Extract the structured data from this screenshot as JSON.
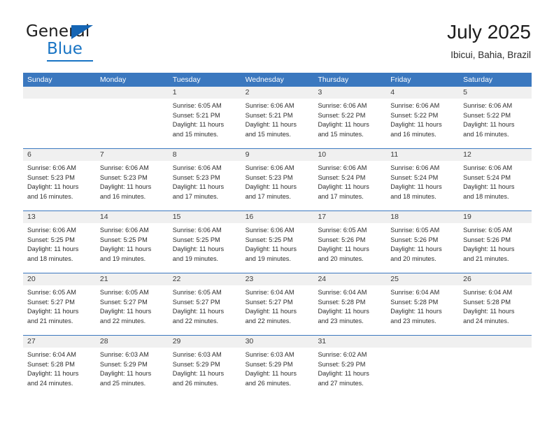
{
  "brand": {
    "word_one": "General",
    "word_two": "Blue",
    "accent_color": "#1874c4",
    "triangle_color": "#1565b4"
  },
  "header": {
    "title": "July 2025",
    "subtitle": "Ibicui, Bahia, Brazil"
  },
  "calendar": {
    "header_bg": "#3b78bf",
    "daynum_bg": "#f0f0f0",
    "weekdays": [
      "Sunday",
      "Monday",
      "Tuesday",
      "Wednesday",
      "Thursday",
      "Friday",
      "Saturday"
    ],
    "weeks": [
      [
        {
          "day": "",
          "lines": []
        },
        {
          "day": "",
          "lines": []
        },
        {
          "day": "1",
          "lines": [
            "Sunrise: 6:05 AM",
            "Sunset: 5:21 PM",
            "Daylight: 11 hours",
            "and 15 minutes."
          ]
        },
        {
          "day": "2",
          "lines": [
            "Sunrise: 6:06 AM",
            "Sunset: 5:21 PM",
            "Daylight: 11 hours",
            "and 15 minutes."
          ]
        },
        {
          "day": "3",
          "lines": [
            "Sunrise: 6:06 AM",
            "Sunset: 5:22 PM",
            "Daylight: 11 hours",
            "and 15 minutes."
          ]
        },
        {
          "day": "4",
          "lines": [
            "Sunrise: 6:06 AM",
            "Sunset: 5:22 PM",
            "Daylight: 11 hours",
            "and 16 minutes."
          ]
        },
        {
          "day": "5",
          "lines": [
            "Sunrise: 6:06 AM",
            "Sunset: 5:22 PM",
            "Daylight: 11 hours",
            "and 16 minutes."
          ]
        }
      ],
      [
        {
          "day": "6",
          "lines": [
            "Sunrise: 6:06 AM",
            "Sunset: 5:23 PM",
            "Daylight: 11 hours",
            "and 16 minutes."
          ]
        },
        {
          "day": "7",
          "lines": [
            "Sunrise: 6:06 AM",
            "Sunset: 5:23 PM",
            "Daylight: 11 hours",
            "and 16 minutes."
          ]
        },
        {
          "day": "8",
          "lines": [
            "Sunrise: 6:06 AM",
            "Sunset: 5:23 PM",
            "Daylight: 11 hours",
            "and 17 minutes."
          ]
        },
        {
          "day": "9",
          "lines": [
            "Sunrise: 6:06 AM",
            "Sunset: 5:23 PM",
            "Daylight: 11 hours",
            "and 17 minutes."
          ]
        },
        {
          "day": "10",
          "lines": [
            "Sunrise: 6:06 AM",
            "Sunset: 5:24 PM",
            "Daylight: 11 hours",
            "and 17 minutes."
          ]
        },
        {
          "day": "11",
          "lines": [
            "Sunrise: 6:06 AM",
            "Sunset: 5:24 PM",
            "Daylight: 11 hours",
            "and 18 minutes."
          ]
        },
        {
          "day": "12",
          "lines": [
            "Sunrise: 6:06 AM",
            "Sunset: 5:24 PM",
            "Daylight: 11 hours",
            "and 18 minutes."
          ]
        }
      ],
      [
        {
          "day": "13",
          "lines": [
            "Sunrise: 6:06 AM",
            "Sunset: 5:25 PM",
            "Daylight: 11 hours",
            "and 18 minutes."
          ]
        },
        {
          "day": "14",
          "lines": [
            "Sunrise: 6:06 AM",
            "Sunset: 5:25 PM",
            "Daylight: 11 hours",
            "and 19 minutes."
          ]
        },
        {
          "day": "15",
          "lines": [
            "Sunrise: 6:06 AM",
            "Sunset: 5:25 PM",
            "Daylight: 11 hours",
            "and 19 minutes."
          ]
        },
        {
          "day": "16",
          "lines": [
            "Sunrise: 6:06 AM",
            "Sunset: 5:25 PM",
            "Daylight: 11 hours",
            "and 19 minutes."
          ]
        },
        {
          "day": "17",
          "lines": [
            "Sunrise: 6:05 AM",
            "Sunset: 5:26 PM",
            "Daylight: 11 hours",
            "and 20 minutes."
          ]
        },
        {
          "day": "18",
          "lines": [
            "Sunrise: 6:05 AM",
            "Sunset: 5:26 PM",
            "Daylight: 11 hours",
            "and 20 minutes."
          ]
        },
        {
          "day": "19",
          "lines": [
            "Sunrise: 6:05 AM",
            "Sunset: 5:26 PM",
            "Daylight: 11 hours",
            "and 21 minutes."
          ]
        }
      ],
      [
        {
          "day": "20",
          "lines": [
            "Sunrise: 6:05 AM",
            "Sunset: 5:27 PM",
            "Daylight: 11 hours",
            "and 21 minutes."
          ]
        },
        {
          "day": "21",
          "lines": [
            "Sunrise: 6:05 AM",
            "Sunset: 5:27 PM",
            "Daylight: 11 hours",
            "and 22 minutes."
          ]
        },
        {
          "day": "22",
          "lines": [
            "Sunrise: 6:05 AM",
            "Sunset: 5:27 PM",
            "Daylight: 11 hours",
            "and 22 minutes."
          ]
        },
        {
          "day": "23",
          "lines": [
            "Sunrise: 6:04 AM",
            "Sunset: 5:27 PM",
            "Daylight: 11 hours",
            "and 22 minutes."
          ]
        },
        {
          "day": "24",
          "lines": [
            "Sunrise: 6:04 AM",
            "Sunset: 5:28 PM",
            "Daylight: 11 hours",
            "and 23 minutes."
          ]
        },
        {
          "day": "25",
          "lines": [
            "Sunrise: 6:04 AM",
            "Sunset: 5:28 PM",
            "Daylight: 11 hours",
            "and 23 minutes."
          ]
        },
        {
          "day": "26",
          "lines": [
            "Sunrise: 6:04 AM",
            "Sunset: 5:28 PM",
            "Daylight: 11 hours",
            "and 24 minutes."
          ]
        }
      ],
      [
        {
          "day": "27",
          "lines": [
            "Sunrise: 6:04 AM",
            "Sunset: 5:28 PM",
            "Daylight: 11 hours",
            "and 24 minutes."
          ]
        },
        {
          "day": "28",
          "lines": [
            "Sunrise: 6:03 AM",
            "Sunset: 5:29 PM",
            "Daylight: 11 hours",
            "and 25 minutes."
          ]
        },
        {
          "day": "29",
          "lines": [
            "Sunrise: 6:03 AM",
            "Sunset: 5:29 PM",
            "Daylight: 11 hours",
            "and 26 minutes."
          ]
        },
        {
          "day": "30",
          "lines": [
            "Sunrise: 6:03 AM",
            "Sunset: 5:29 PM",
            "Daylight: 11 hours",
            "and 26 minutes."
          ]
        },
        {
          "day": "31",
          "lines": [
            "Sunrise: 6:02 AM",
            "Sunset: 5:29 PM",
            "Daylight: 11 hours",
            "and 27 minutes."
          ]
        },
        {
          "day": "",
          "lines": []
        },
        {
          "day": "",
          "lines": []
        }
      ]
    ]
  }
}
